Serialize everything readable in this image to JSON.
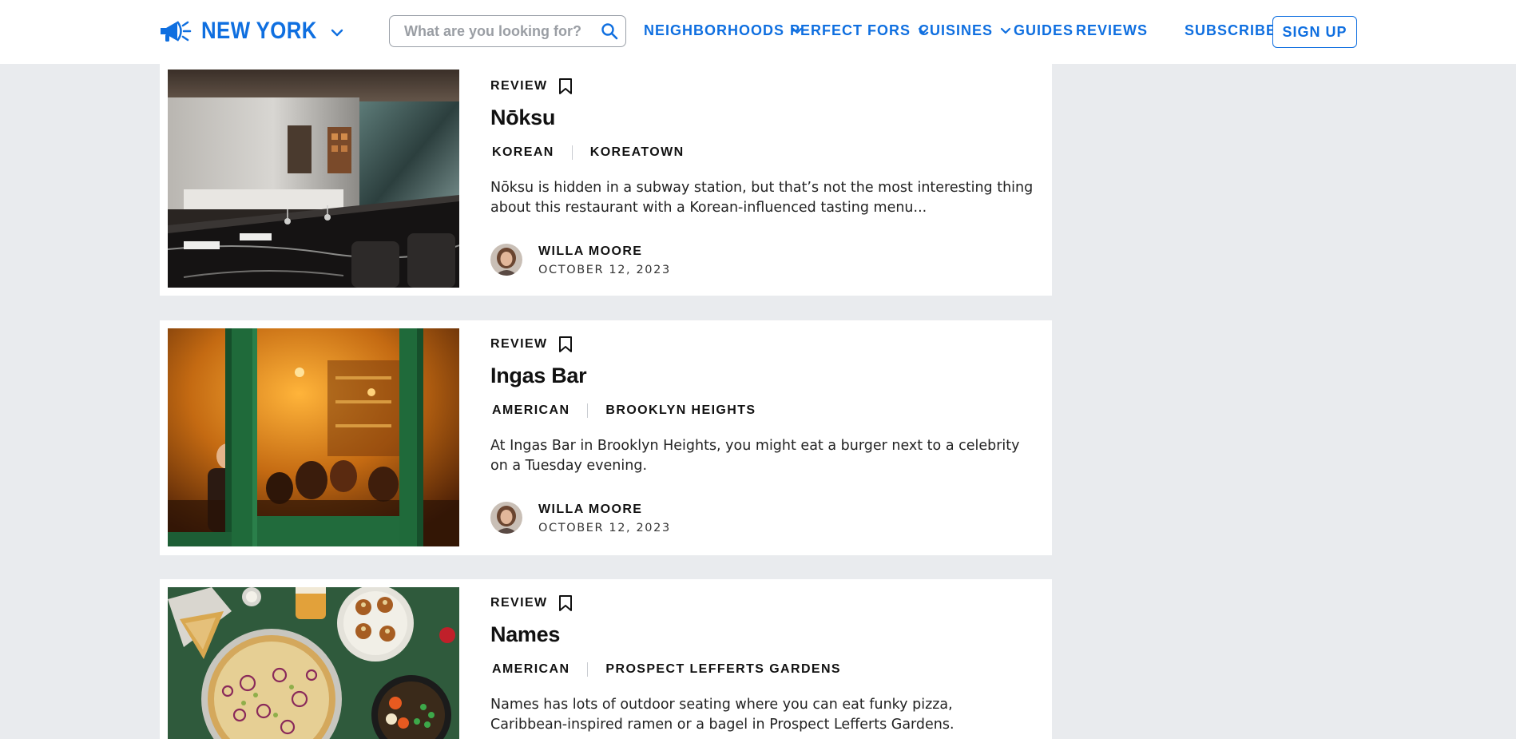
{
  "header": {
    "city": "NEW YORK",
    "search_placeholder": "What are you looking for?",
    "nav": [
      {
        "label": "NEIGHBORHOODS",
        "has_dropdown": true
      },
      {
        "label": "PERFECT FORS",
        "has_dropdown": true
      },
      {
        "label": "CUISINES",
        "has_dropdown": true
      },
      {
        "label": "GUIDES",
        "has_dropdown": false
      },
      {
        "label": "REVIEWS",
        "has_dropdown": false
      }
    ],
    "subscribe": "SUBSCRIBE",
    "signup": "SIGN UP"
  },
  "reviews": [
    {
      "type": "REVIEW",
      "title": "Nōksu",
      "tags": [
        "KOREAN",
        "KOREATOWN"
      ],
      "description": "Nōksu is hidden in a subway station, but that’s not the most interesting thing about this restaurant with a Korean-influenced tasting menu...",
      "author": "WILLA MOORE",
      "date": "OCTOBER 12, 2023"
    },
    {
      "type": "REVIEW",
      "title": "Ingas Bar",
      "tags": [
        "AMERICAN",
        "BROOKLYN HEIGHTS"
      ],
      "description": "At Ingas Bar in Brooklyn Heights, you might eat a burger next to a celebrity on a Tuesday evening.",
      "author": "WILLA MOORE",
      "date": "OCTOBER 12, 2023"
    },
    {
      "type": "REVIEW",
      "title": "Names",
      "tags": [
        "AMERICAN",
        "PROSPECT LEFFERTS GARDENS"
      ],
      "description": "Names has lots of outdoor seating where you can eat funky pizza, Caribbean-inspired ramen or a bagel in Prospect Lefferts Gardens.",
      "author": "",
      "date": ""
    }
  ],
  "colors": {
    "accent": "#0f6fe0",
    "page_background": "#e9ebee",
    "card_background": "#ffffff",
    "text": "#111111"
  },
  "icons": {
    "logo": "megaphone-icon",
    "city_dropdown": "chevron-down-icon",
    "search": "search-icon",
    "bookmark": "bookmark-icon"
  }
}
